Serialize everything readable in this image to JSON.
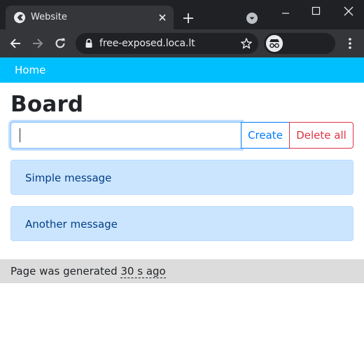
{
  "browser": {
    "tab_title": "Website",
    "url": "free-exposed.loca.lt",
    "icons": {
      "favicon": "site-favicon-icon",
      "tab_close": "close-icon",
      "new_tab": "plus-icon",
      "tab_search": "chevron-down-icon",
      "back": "arrow-left-icon",
      "forward": "arrow-right-icon",
      "reload": "reload-icon",
      "lock": "lock-icon",
      "bookmark": "star-icon",
      "profile": "incognito-icon",
      "menu": "vertical-dots-icon"
    },
    "colors": {
      "frame": "#202124",
      "toolbar": "#35363a",
      "text": "#e8eaed"
    }
  },
  "navbar": {
    "home_label": "Home",
    "color": "#00bfff"
  },
  "page": {
    "title": "Board"
  },
  "form": {
    "input_value": "",
    "input_placeholder": "",
    "create_label": "Create",
    "delete_all_label": "Delete all"
  },
  "messages": [
    {
      "text": "Simple message"
    },
    {
      "text": "Another message"
    }
  ],
  "footer": {
    "prefix": "Page was generated ",
    "age": "30 s ago"
  }
}
